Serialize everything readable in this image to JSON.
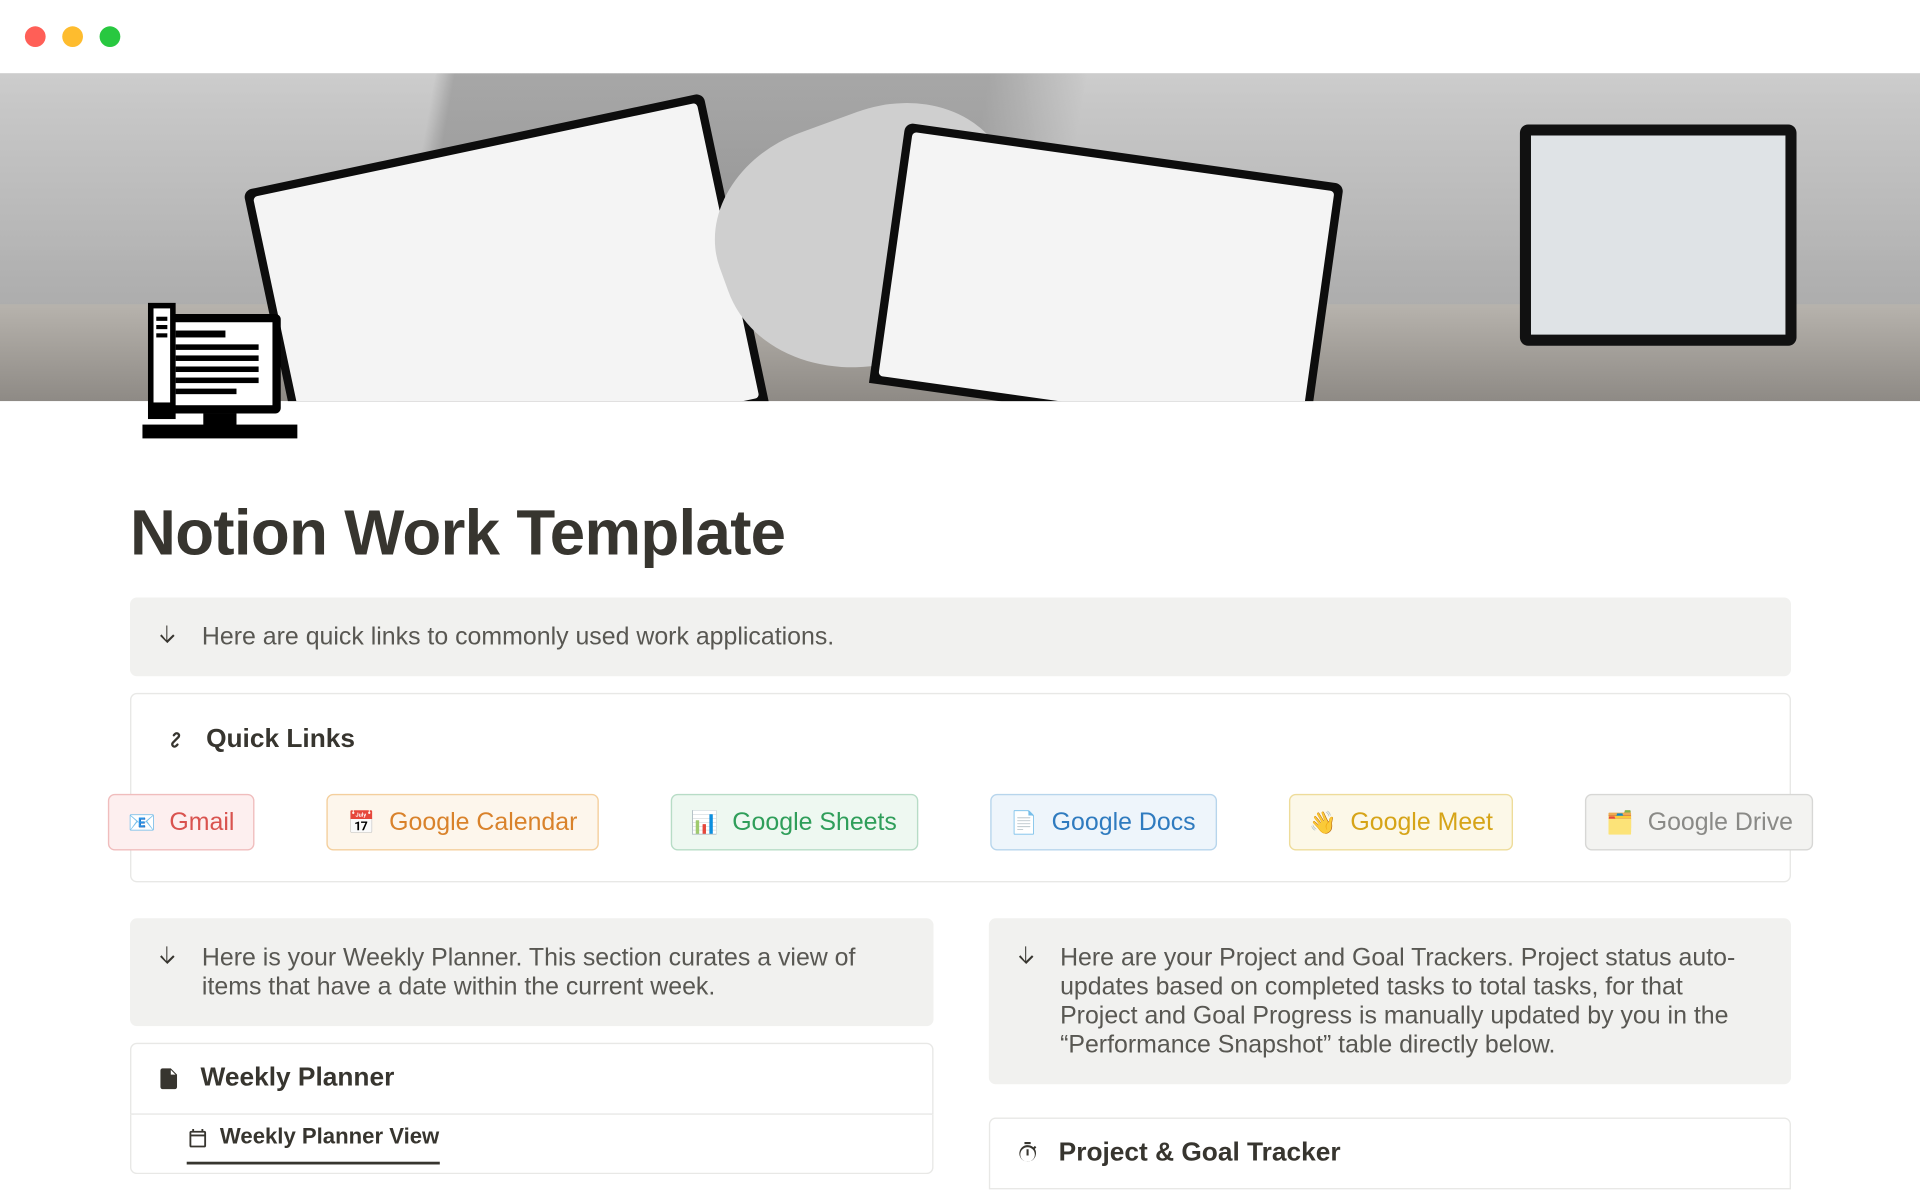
{
  "page": {
    "title": "Notion Work Template"
  },
  "callouts": {
    "quicklinks": "Here are quick links to commonly used work applications.",
    "weekly": "Here is your Weekly Planner. This section curates a view of items that have a date within the current week.",
    "trackers": "Here are your Project and Goal Trackers. Project status auto-updates based on completed tasks to total tasks, for that Project and Goal Progress is manually updated by you in the “Performance Snapshot” table directly below."
  },
  "quicklinks": {
    "heading": "Quick Links",
    "items": [
      {
        "emoji": "📧",
        "label": "Gmail",
        "color": "red"
      },
      {
        "emoji": "📅",
        "label": "Google Calendar",
        "color": "orange"
      },
      {
        "emoji": "📊",
        "label": "Google Sheets",
        "color": "green"
      },
      {
        "emoji": "📄",
        "label": "Google Docs",
        "color": "blue"
      },
      {
        "emoji": "👋",
        "label": "Google Meet",
        "color": "yellow"
      },
      {
        "emoji": "🗂️",
        "label": "Google Drive",
        "color": "gray"
      }
    ]
  },
  "sections": {
    "weekly": {
      "title": "Weekly Planner",
      "view": "Weekly Planner View"
    },
    "tracker": {
      "title": "Project & Goal Tracker"
    }
  }
}
